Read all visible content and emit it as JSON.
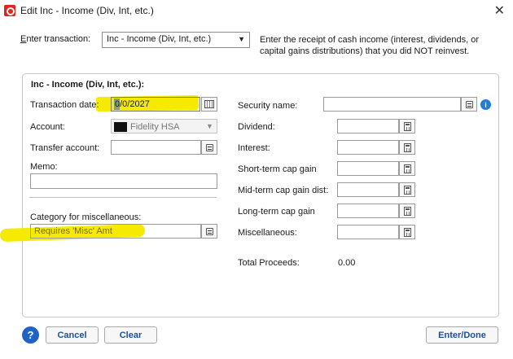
{
  "window": {
    "title": "Edit Inc - Income (Div, Int, etc.)",
    "close_glyph": "✕"
  },
  "enter_transaction": {
    "label": "Enter transaction:",
    "selected": "Inc - Income (Div, Int, etc.)",
    "description_line1": "Enter the receipt of cash income (interest, dividends, or",
    "description_line2": "capital gains distributions) that you did NOT reinvest."
  },
  "form": {
    "group_title": "Inc - Income (Div, Int, etc.):",
    "transaction_date": {
      "label": "Transaction date:",
      "value": "0/0/2027"
    },
    "account": {
      "label": "Account:",
      "value": "Fidelity HSA"
    },
    "transfer_account": {
      "label": "Transfer account:",
      "value": ""
    },
    "memo": {
      "label": "Memo:",
      "value": ""
    },
    "misc_category": {
      "label": "Category for miscellaneous:",
      "placeholder": "Requires 'Misc' Amt"
    },
    "security_name": {
      "label": "Security name:",
      "value": ""
    },
    "dividend": {
      "label": "Dividend:",
      "value": ""
    },
    "interest": {
      "label": "Interest:",
      "value": ""
    },
    "short_term_cap_gain": {
      "label": "Short-term cap gain",
      "value": ""
    },
    "mid_term_cap_gain_dist": {
      "label": "Mid-term cap gain dist:",
      "value": ""
    },
    "long_term_cap_gain": {
      "label": "Long-term cap gain",
      "value": ""
    },
    "miscellaneous": {
      "label": "Miscellaneous:",
      "value": ""
    },
    "total_proceeds": {
      "label": "Total Proceeds:",
      "value": "0.00"
    }
  },
  "footer": {
    "help": "?",
    "cancel": "Cancel",
    "clear": "Clear",
    "enter_done": "Enter/Done"
  },
  "colors": {
    "highlight": "#f5ea00",
    "brand": "#e0231c",
    "link": "#1d4f9b"
  }
}
